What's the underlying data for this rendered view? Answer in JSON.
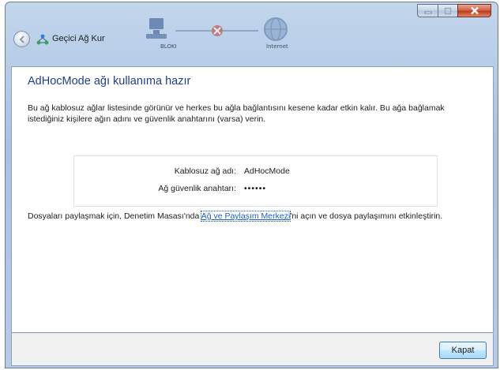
{
  "window": {
    "title": "Geçici Ağ Kur",
    "background_diagram": {
      "left_caption": "BLOKI",
      "right_caption": "İnternet"
    }
  },
  "content": {
    "heading": "AdHocMode ağı kullanıma hazır",
    "description": "Bu ağ kablosuz ağlar listesinde görünür ve herkes bu ağla bağlantısını kesene kadar etkin kalır. Bu ağa bağlamak istediğiniz kişilere ağın adını ve güvenlik anahtarını (varsa) verin.",
    "network": {
      "name_label": "Kablosuz ağ adı:",
      "name_value": "AdHocMode",
      "key_label": "Ağ güvenlik anahtarı:",
      "key_value": "••••••"
    },
    "share": {
      "before": "Dosyaları paylaşmak için, Denetim Masası'nda ",
      "link": "Ağ ve Paylaşım Merkezi",
      "after": "'ni açın ve dosya paylaşımını etkinleştirin."
    }
  },
  "footer": {
    "close_label": "Kapat"
  },
  "colors": {
    "heading": "#1e3f8a",
    "link": "#1a5fc9",
    "titlebar": "#b6cbe6",
    "close_caption": "#c0391b"
  }
}
